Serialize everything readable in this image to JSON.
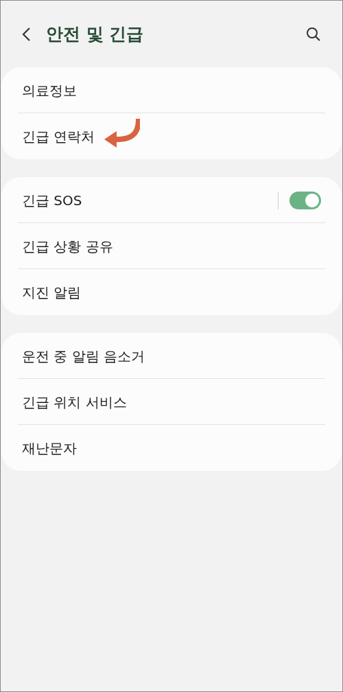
{
  "header": {
    "title": "안전 및 긴급"
  },
  "groups": [
    {
      "items": [
        {
          "label": "의료정보",
          "kind": "link",
          "marked": false
        },
        {
          "label": "긴급 연락처",
          "kind": "link",
          "marked": true
        }
      ]
    },
    {
      "items": [
        {
          "label": "긴급 SOS",
          "kind": "toggle",
          "on": true,
          "marked": false
        },
        {
          "label": "긴급 상황 공유",
          "kind": "link",
          "marked": false
        },
        {
          "label": "지진 알림",
          "kind": "link",
          "marked": false
        }
      ]
    },
    {
      "items": [
        {
          "label": "운전 중 알림 음소거",
          "kind": "link",
          "marked": false
        },
        {
          "label": "긴급 위치 서비스",
          "kind": "link",
          "marked": false
        },
        {
          "label": "재난문자",
          "kind": "link",
          "marked": false
        }
      ]
    }
  ]
}
